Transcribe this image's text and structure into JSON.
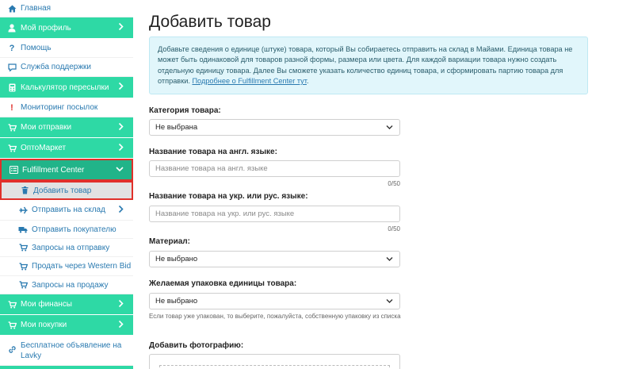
{
  "colors": {
    "accent_green": "#2ed9a5",
    "active_green": "#21b489",
    "highlight_red": "#e0302a",
    "link_blue": "#2a7ab0"
  },
  "sidebar": {
    "items": [
      {
        "label": "Главная",
        "icon": "home-icon"
      },
      {
        "label": "Мой профиль",
        "icon": "user-icon"
      },
      {
        "label": "Помощь",
        "icon": "question-icon"
      },
      {
        "label": "Служба поддержки",
        "icon": "chat-icon"
      },
      {
        "label": "Калькулятор пересылки",
        "icon": "calculator-icon"
      },
      {
        "label": "Мониторинг посылок",
        "icon": "exclamation-icon"
      },
      {
        "label": "Мои отправки",
        "icon": "cart-icon"
      },
      {
        "label": "ОптоМаркет",
        "icon": "cart-icon"
      },
      {
        "label": "Fulfillment Center",
        "icon": "list-icon"
      },
      {
        "label": "Добавить товар",
        "icon": "trash-icon"
      },
      {
        "label": "Отправить на склад",
        "icon": "plane-icon"
      },
      {
        "label": "Отправить покупателю",
        "icon": "truck-icon"
      },
      {
        "label": "Запросы на отправку",
        "icon": "cart-icon"
      },
      {
        "label": "Продать через Western Bid",
        "icon": "cart-icon"
      },
      {
        "label": "Запросы на продажу",
        "icon": "cart-icon"
      },
      {
        "label": "Мои финансы",
        "icon": "cart-icon"
      },
      {
        "label": "Мои покупки",
        "icon": "cart-icon"
      },
      {
        "label": "Бесплатное объявление на Lavky",
        "icon": "link-icon"
      }
    ]
  },
  "main": {
    "title": "Добавить товар",
    "info_text": "Добавьте сведения о единице (штуке) товара, который Вы собираетесь отправить на склад в Майами. Единица товара не может быть одинаковой для товаров разной формы, размера или цвета. Для каждой вариации товара нужно создать отдельную единицу товара. Далее Вы сможете указать количество единиц товара, и сформировать партию товара для отправки. ",
    "info_link": "Подробнее о Fulfillment Center тут",
    "info_end": ".",
    "category": {
      "label": "Категория товара:",
      "value": "Не выбрана"
    },
    "name_en": {
      "label": "Название товара на англ. языке:",
      "placeholder": "Название товара на англ. языке",
      "counter": "0/50"
    },
    "name_ru": {
      "label": "Название товара на укр. или рус. языке:",
      "placeholder": "Название товара на укр. или рус. языке",
      "counter": "0/50"
    },
    "material": {
      "label": "Материал:",
      "value": "Не выбрано"
    },
    "packaging": {
      "label": "Желаемая упаковка единицы товара:",
      "value": "Не выбрано",
      "hint": "Если товар уже упакован, то выберите, пожалуйста, собственную упаковку из списка"
    },
    "photo": {
      "label": "Добавить фотографию:"
    }
  }
}
